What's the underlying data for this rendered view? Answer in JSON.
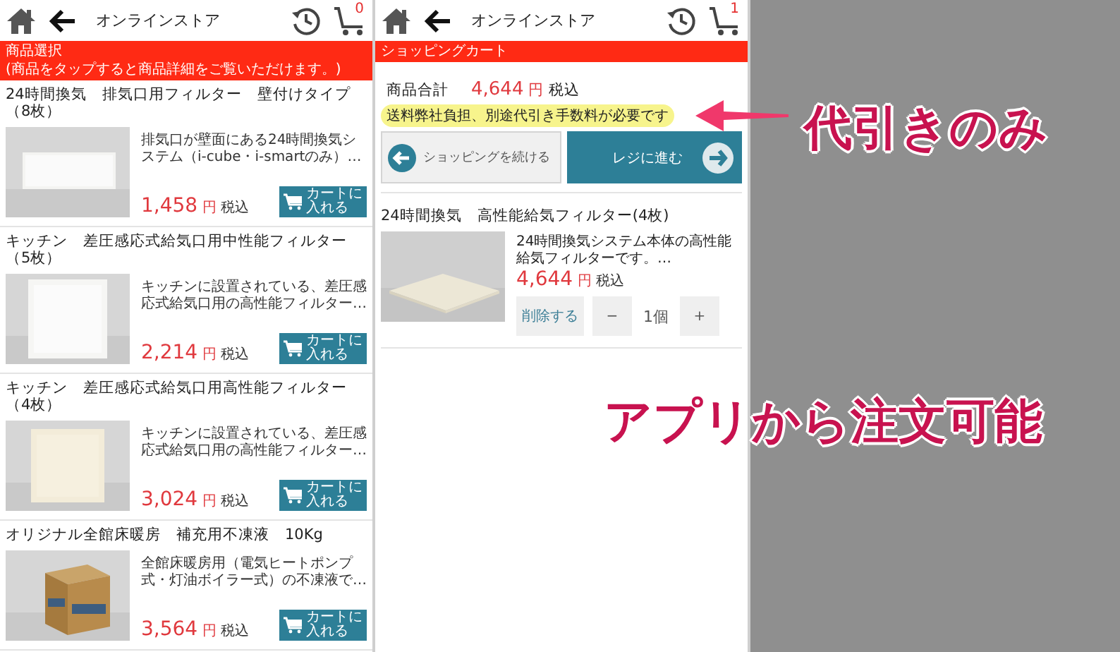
{
  "screens": [
    {
      "header": {
        "title": "オンラインストア",
        "cart_count": "0"
      },
      "banner": {
        "title": "商品選択",
        "hint": "(商品をタップすると商品詳細をご覧いただけます。)"
      },
      "products": [
        {
          "name": "24時間換気　排気口用フィルター　壁付けタイプ（8枚）",
          "description": "排気口が壁面にある24時間換気システム（i-cube・i-smartのみ）…",
          "price": "1,458",
          "currency": "円",
          "tax": "税込",
          "cart_button": "カートに入れる"
        },
        {
          "name": "キッチン　差圧感応式給気口用中性能フィルター（5枚）",
          "description": "キッチンに設置されている、差圧感応式給気口用の高性能フィルター…",
          "price": "2,214",
          "currency": "円",
          "tax": "税込",
          "cart_button": "カートに入れる"
        },
        {
          "name": "キッチン　差圧感応式給気口用高性能フィルター（4枚）",
          "description": "キッチンに設置されている、差圧感応式給気口用の高性能フィルター…",
          "price": "3,024",
          "currency": "円",
          "tax": "税込",
          "cart_button": "カートに入れる"
        },
        {
          "name": "オリジナル全館床暖房　補充用不凍液　10Kg",
          "description": "全館床暖房用（電気ヒートポンプ式・灯油ボイラー式）の不凍液で…",
          "price": "3,564",
          "currency": "円",
          "tax": "税込",
          "cart_button": "カートに入れる"
        }
      ]
    },
    {
      "header": {
        "title": "オンラインストア",
        "cart_count": "1"
      },
      "banner": {
        "title": "ショッピングカート"
      },
      "cart": {
        "total_label": "商品合計",
        "total": "4,644",
        "currency": "円",
        "tax": "税込",
        "note": "送料弊社負担、別途代引き手数料が必要です",
        "continue_button": "ショッピングを続ける",
        "checkout_button": "レジに進む",
        "items": [
          {
            "name": "24時間換気　高性能給気フィルター(4枚)",
            "description": "24時間換気システム本体の高性能給気フィルターです。…",
            "price": "4,644",
            "currency": "円",
            "tax": "税込",
            "delete_button": "削除する",
            "minus": "−",
            "quantity": "1個",
            "plus": "+"
          }
        ]
      }
    }
  ],
  "annotations": [
    {
      "text": "代引きのみ"
    },
    {
      "text": "アプリから注文可能"
    }
  ]
}
